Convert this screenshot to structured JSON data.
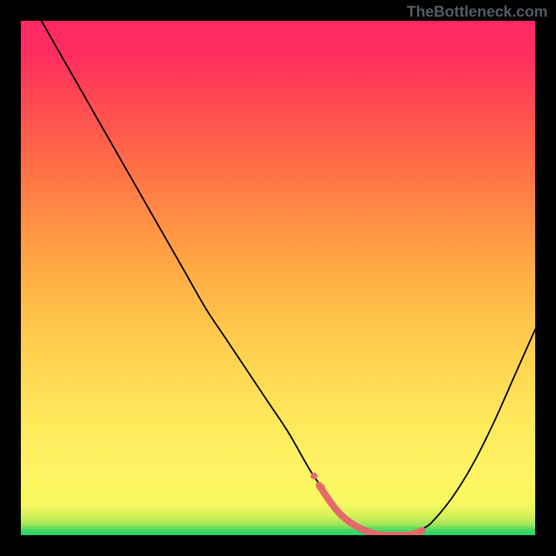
{
  "watermark": "TheBottleneck.com",
  "chart_data": {
    "type": "line",
    "title": "",
    "xlabel": "",
    "ylabel": "",
    "xlim": [
      0,
      100
    ],
    "ylim": [
      0,
      100
    ],
    "grid": false,
    "legend": false,
    "background_gradient": {
      "top": "#ff2864",
      "mid": "#ffe95b",
      "bottom": "#1fd66b"
    },
    "series": [
      {
        "name": "curve",
        "color": "#000000",
        "x": [
          4,
          8,
          12,
          16,
          20,
          24,
          28,
          32,
          36,
          40,
          44,
          48,
          52,
          56,
          58,
          60,
          62,
          64,
          66,
          68,
          70,
          72,
          74,
          76,
          78,
          80,
          84,
          88,
          92,
          96,
          100
        ],
        "y": [
          100,
          93,
          86,
          79,
          72,
          65,
          58,
          51,
          44,
          38,
          32,
          26,
          20,
          13,
          10,
          7,
          4.5,
          2.8,
          1.6,
          0.8,
          0.3,
          0.1,
          0.1,
          0.4,
          1.2,
          2.6,
          7.5,
          14,
          22,
          31,
          40
        ]
      }
    ],
    "highlight": {
      "color": "#e46a6a",
      "range_x": [
        58,
        78
      ],
      "extra_points_x": [
        57,
        58.5
      ],
      "note": "flat minimum segment marked with thick salmon stroke and two leading dots"
    }
  }
}
